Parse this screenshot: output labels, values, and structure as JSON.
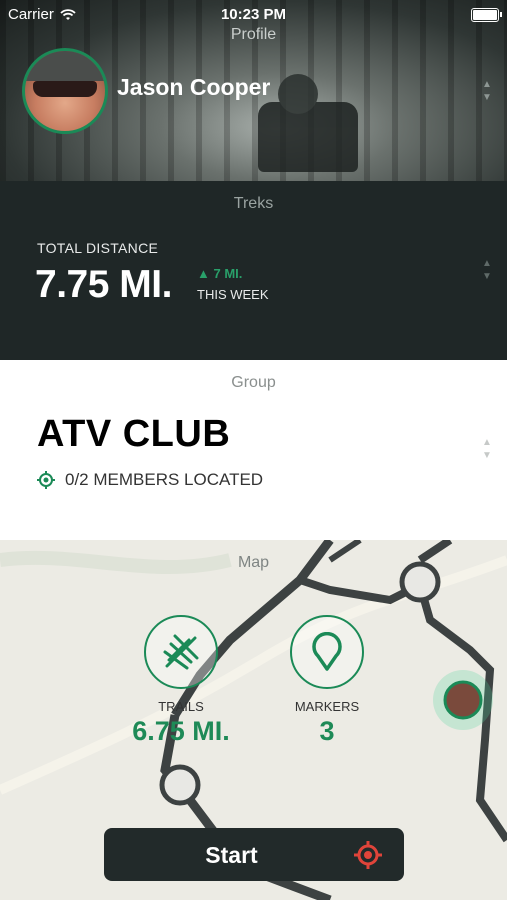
{
  "status_bar": {
    "carrier": "Carrier",
    "time": "10:23 PM"
  },
  "profile": {
    "section_title": "Profile",
    "name": "Jason Cooper"
  },
  "treks": {
    "section_title": "Treks",
    "total_label": "TOTAL DISTANCE",
    "total_value": "7.75 MI.",
    "week_delta": "▲ 7 MI.",
    "week_label": "THIS WEEK"
  },
  "group": {
    "section_title": "Group",
    "name": "ATV CLUB",
    "members_text": "0/2 MEMBERS LOCATED"
  },
  "map": {
    "section_title": "Map",
    "trails": {
      "label": "TRAILS",
      "value": "6.75 MI."
    },
    "markers": {
      "label": "MARKERS",
      "value": "3"
    }
  },
  "start_button": {
    "label": "Start"
  },
  "colors": {
    "accent_green": "#1b8a57",
    "dark_panel": "#1f2727",
    "alert_red": "#e0443a"
  }
}
